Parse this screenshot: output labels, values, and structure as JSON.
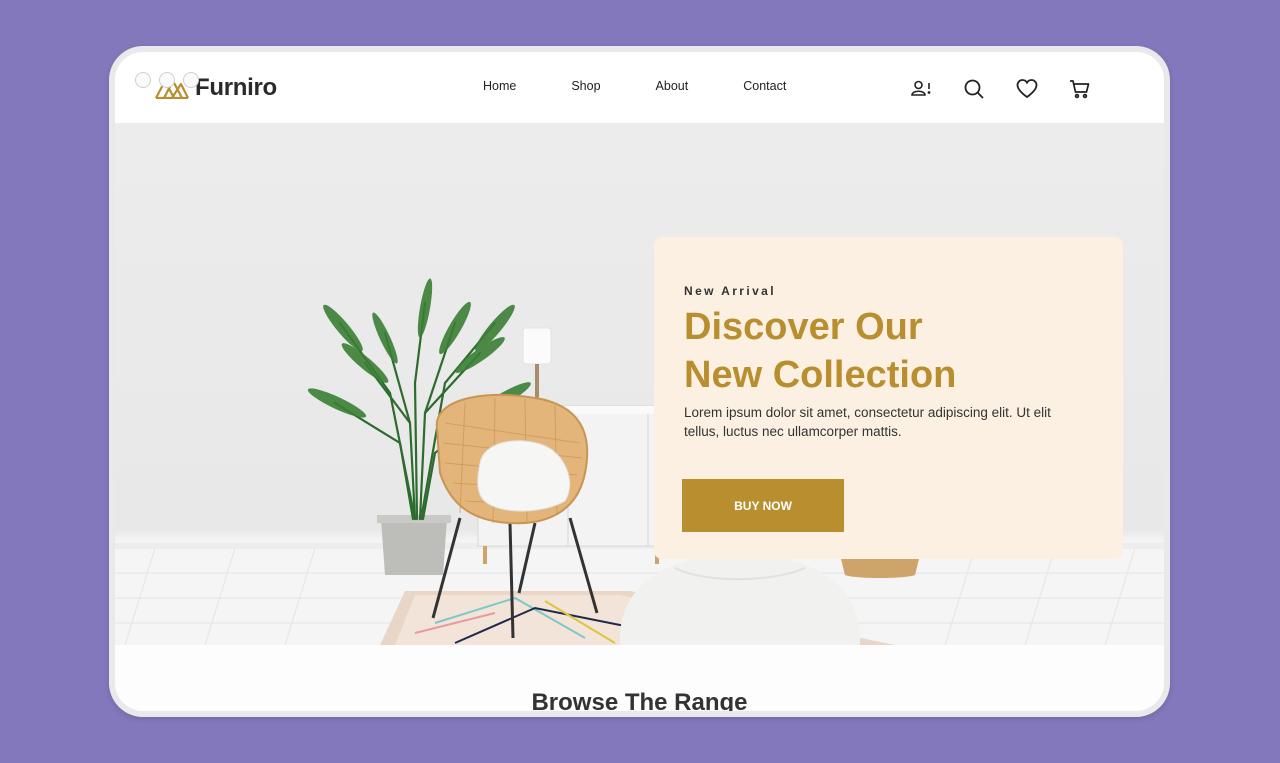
{
  "brand": {
    "name": "Furniro",
    "accent": "#b88e2f"
  },
  "nav": {
    "items": [
      "Home",
      "Shop",
      "About",
      "Contact"
    ]
  },
  "header_icons": [
    "user-alert-icon",
    "search-icon",
    "heart-icon",
    "cart-icon"
  ],
  "hero": {
    "eyebrow": "New Arrival",
    "headline_line1": "Discover Our",
    "headline_line2": "New Collection",
    "description": "Lorem ipsum dolor sit amet, consectetur adipiscing elit. Ut elit tellus, luctus nec ullamcorper mattis.",
    "cta_label": "BUY NOW"
  },
  "section": {
    "title": "Browse The Range"
  },
  "colors": {
    "background": "#8278bb",
    "promo_bg": "#fcf0e3",
    "accent": "#b88e2f"
  }
}
